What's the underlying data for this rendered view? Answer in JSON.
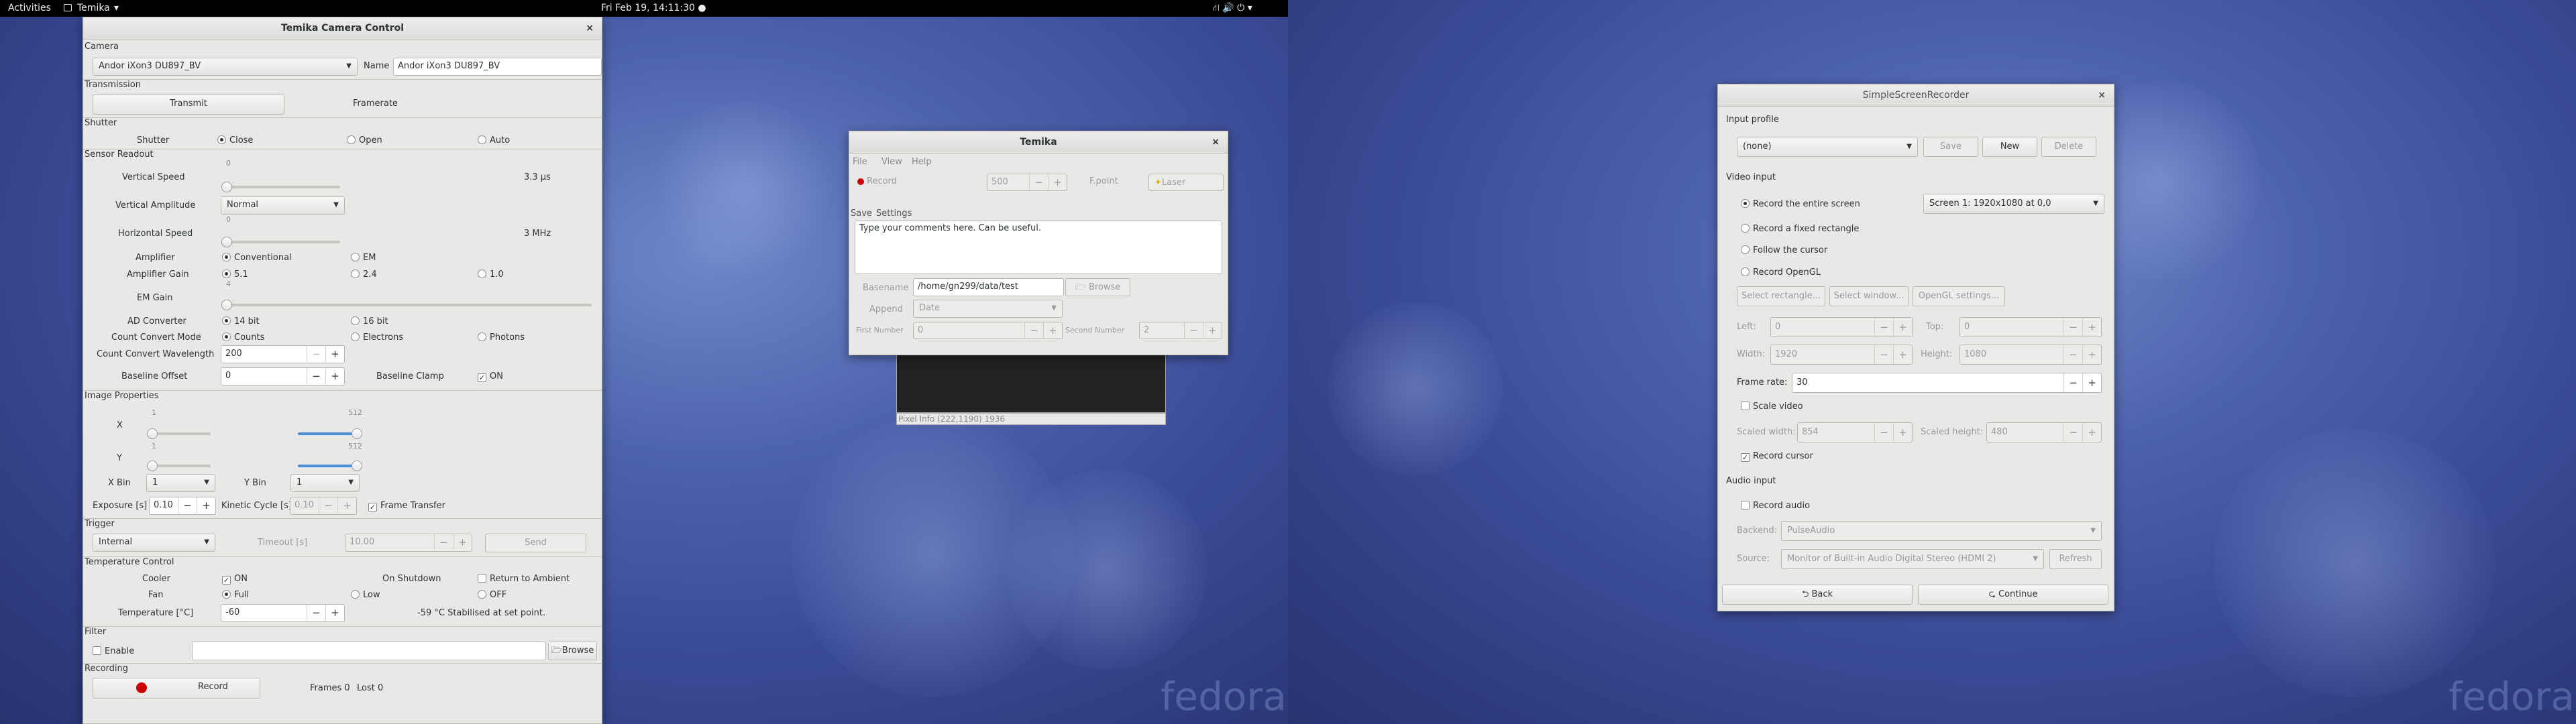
{
  "topbar": {
    "activities": "Activities",
    "app": "Temika",
    "app_arrow": "▾",
    "clock": "Fri Feb 19, 14:11:30 ●",
    "tray": "⛙  🔊  ⏻ ▾"
  },
  "temika_control": {
    "title": "Temika Camera Control",
    "close": "×",
    "camera": {
      "section": "Camera",
      "device": "Andor iXon3 DU897_BV",
      "name_label": "Name",
      "name_value": "Andor iXon3 DU897_BV"
    },
    "transmission": {
      "section": "Transmission",
      "transmit": "Transmit",
      "framerate": "Framerate"
    },
    "shutter": {
      "section": "Shutter",
      "label": "Shutter",
      "close": "Close",
      "open": "Open",
      "auto": "Auto"
    },
    "readout": {
      "section": "Sensor Readout",
      "vspeed_label": "Vertical Speed",
      "vspeed_tick": "0",
      "vspeed_value": "3.3 µs",
      "vamp_label": "Vertical Amplitude",
      "vamp_value": "Normal",
      "hspeed_label": "Horizontal Speed",
      "hspeed_tick": "0",
      "hspeed_value": "3 MHz",
      "amp_label": "Amplifier",
      "amp_conv": "Conventional",
      "amp_em": "EM",
      "gain_label": "Amplifier Gain",
      "gain_1": "5.1",
      "gain_2": "2.4",
      "gain_3": "1.0",
      "emgain_label": "EM Gain",
      "emgain_tick": "4",
      "ad_label": "AD Converter",
      "ad_14": "14 bit",
      "ad_16": "16 bit",
      "ccm_label": "Count Convert Mode",
      "ccm_counts": "Counts",
      "ccm_electrons": "Electrons",
      "ccm_photons": "Photons",
      "ccw_label": "Count Convert Wavelength",
      "ccw_value": "200",
      "bo_label": "Baseline Offset",
      "bo_value": "0",
      "bc_label": "Baseline Clamp",
      "bc_value": "ON"
    },
    "image": {
      "section": "Image Properties",
      "x_label": "X",
      "y_label": "Y",
      "x_min": "1",
      "x_max": "512",
      "y_min": "1",
      "y_max": "512",
      "xbin_label": "X Bin",
      "xbin_value": "1",
      "ybin_label": "Y Bin",
      "ybin_value": "1",
      "exposure_label": "Exposure [s]",
      "exposure_value": "0.10",
      "kinetic_label": "Kinetic Cycle [s]",
      "kinetic_value": "0.10",
      "frame_transfer": "Frame Transfer"
    },
    "trigger": {
      "section": "Trigger",
      "mode": "Internal",
      "timeout_label": "Timeout [s]",
      "timeout_value": "10.00",
      "send": "Send"
    },
    "temperature": {
      "section": "Temperature Control",
      "cooler_label": "Cooler",
      "cooler_value": "ON",
      "shutdown_label": "On Shutdown",
      "return_ambient": "Return to Ambient",
      "fan_label": "Fan",
      "fan_full": "Full",
      "fan_low": "Low",
      "fan_off": "OFF",
      "temp_label": "Temperature [°C]",
      "temp_value": "-60",
      "temp_status": "-59 °C  Stabilised at set point."
    },
    "filter": {
      "section": "Filter",
      "enable": "Enable",
      "browse": "Browse"
    },
    "recording": {
      "section": "Recording",
      "record": "Record",
      "frames": "Frames 0",
      "lost": "Lost 0"
    }
  },
  "temika_small": {
    "title": "Temika",
    "close": "×",
    "menu": [
      "File",
      "View",
      "Help"
    ],
    "record": "Record",
    "record_count": "500",
    "fpoint": "F.point",
    "laser": "Laser",
    "tabs": [
      "Save",
      "Settings"
    ],
    "comments": "Type your comments here. Can be useful.",
    "basename_label": "Basename",
    "basename_value": "/home/gn299/data/test",
    "browse": "Browse",
    "append_label": "Append",
    "append_value": "Date",
    "first_label": "First Number",
    "first_value": "0",
    "second_label": "Second Number",
    "second_value": "2"
  },
  "pixel_info": "Pixel Info (222,1190) 1936",
  "ssr": {
    "title": "SimpleScreenRecorder",
    "close": "×",
    "input_profile": "Input profile",
    "profile_value": "(none)",
    "save": "Save",
    "new": "New",
    "delete": "Delete",
    "video_input": "Video input",
    "record_entire": "Record the entire screen",
    "screen_value": "Screen 1: 1920x1080 at 0,0",
    "record_fixed": "Record a fixed rectangle",
    "follow_cursor": "Follow the cursor",
    "record_opengl": "Record OpenGL",
    "select_rect": "Select rectangle...",
    "select_window": "Select window...",
    "opengl_settings": "OpenGL settings...",
    "left_label": "Left:",
    "left_value": "0",
    "top_label": "Top:",
    "top_value": "0",
    "width_label": "Width:",
    "width_value": "1920",
    "height_label": "Height:",
    "height_value": "1080",
    "framerate_label": "Frame rate:",
    "framerate_value": "30",
    "scale_video": "Scale video",
    "sw_label": "Scaled width:",
    "sw_value": "854",
    "sh_label": "Scaled height:",
    "sh_value": "480",
    "record_cursor": "Record cursor",
    "audio_input": "Audio input",
    "record_audio": "Record audio",
    "backend_label": "Backend:",
    "backend_value": "PulseAudio",
    "source_label": "Source:",
    "source_value": "Monitor of Built-in Audio Digital Stereo (HDMI 2)",
    "refresh": "Refresh",
    "back": "Back",
    "continue": "Continue"
  },
  "desktop": {
    "fedora": "fedora"
  },
  "colors": {
    "record_red": "#cc0000",
    "slider_blue": "#4a90d9",
    "window_bg": "#e8e8e7"
  }
}
